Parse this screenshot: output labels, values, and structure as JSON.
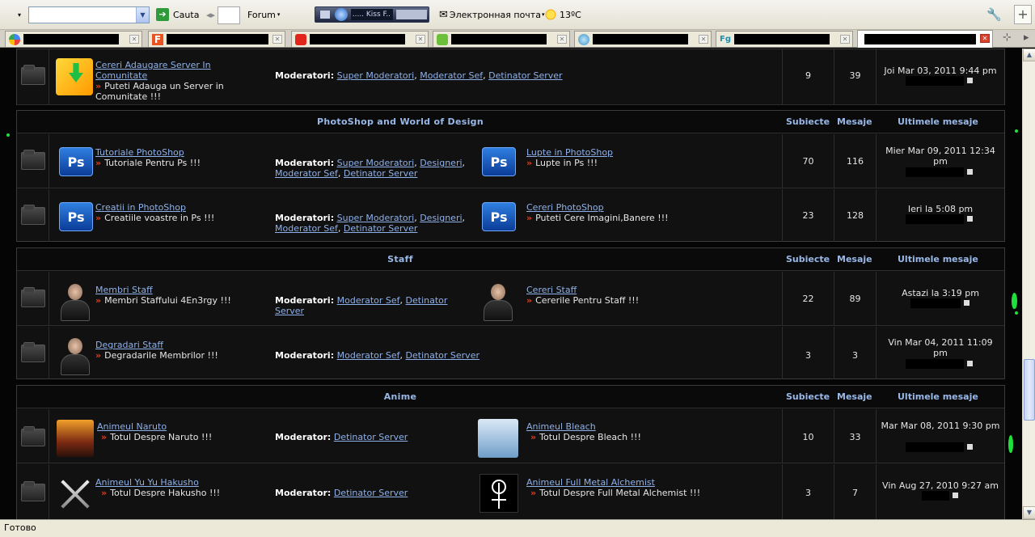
{
  "toolbar": {
    "search_label": "Cauta",
    "forum_label": "Forum",
    "player_title": "..... Kiss F..",
    "email_label": "Электронная почта",
    "weather": "13ºC"
  },
  "tabs": [
    {
      "icon": "google-icon"
    },
    {
      "icon": "f-icon"
    },
    {
      "icon": "youtube-icon"
    },
    {
      "icon": "chat-icon"
    },
    {
      "icon": "globe-icon"
    },
    {
      "icon": "fg-icon"
    },
    {
      "icon": "blank-icon"
    }
  ],
  "header_cols": {
    "topics": "Subiecte",
    "posts": "Mesaje",
    "last": "Ultimele mesaje"
  },
  "mod_label": "Moderatori:",
  "mod_label_single": "Moderator:",
  "top_row": {
    "name": "Cereri Adaugare Server In Comunitate",
    "desc": "Puteti Adauga un Server in Comunitate !!!",
    "mods": [
      "Super Moderatori",
      "Moderator Sef",
      "Detinator Server"
    ],
    "topics": "9",
    "posts": "39",
    "last": "Joi Mar 03, 2011 9:44 pm"
  },
  "categories": [
    {
      "title": "PhotoShop and World of Design",
      "rows": [
        {
          "name": "Tutoriale PhotoShop",
          "desc": "Tutoriale Pentru Ps !!!",
          "mods": [
            "Super Moderatori",
            "Designeri",
            "Moderator Sef",
            "Detinator Server"
          ],
          "sub_name": "Lupte in PhotoShop",
          "sub_desc": "Lupte in Ps !!!",
          "topics": "70",
          "posts": "116",
          "last": "Mier Mar 09, 2011 12:34 pm"
        },
        {
          "name": "Creatii in PhotoShop",
          "desc": "Creatiile voastre in Ps !!!",
          "mods": [
            "Super Moderatori",
            "Designeri",
            "Moderator Sef",
            "Detinator Server"
          ],
          "sub_name": "Cereri PhotoShop",
          "sub_desc": "Puteti Cere Imagini,Banere !!!",
          "topics": "23",
          "posts": "128",
          "last": "Ieri la 5:08 pm"
        }
      ]
    },
    {
      "title": "Staff",
      "rows": [
        {
          "name": "Membri Staff",
          "desc": "Membri Staffului 4En3rgy !!!",
          "mods": [
            "Moderator Sef",
            "Detinator Server"
          ],
          "sub_name": "Cereri Staff",
          "sub_desc": "Cererile Pentru Staff !!!",
          "topics": "22",
          "posts": "89",
          "last": "Astazi la 3:19 pm"
        },
        {
          "name": "Degradari Staff",
          "desc": "Degradarile Membrilor !!!",
          "mods": [
            "Moderator Sef",
            "Detinator Server"
          ],
          "topics": "3",
          "posts": "3",
          "last": "Vin Mar 04, 2011 11:09 pm"
        }
      ]
    },
    {
      "title": "Anime",
      "rows": [
        {
          "name": "Animeul Naruto",
          "desc": "Totul Despre Naruto !!!",
          "mods": [
            "Detinator Server"
          ],
          "sub_name": "Animeul Bleach",
          "sub_desc": "Totul Despre Bleach !!!",
          "topics": "10",
          "posts": "33",
          "last": "Mar Mar 08, 2011 9:30 pm"
        },
        {
          "name": "Animeul Yu Yu Hakusho",
          "desc": "Totul Despre Hakusho !!!",
          "mods": [
            "Detinator Server"
          ],
          "sub_name": "Animeul Full Metal Alchemist",
          "sub_desc": "Totul Despre Full Metal Alchemist !!!",
          "topics": "3",
          "posts": "7",
          "last": "Vin Aug 27, 2010 9:27 am"
        }
      ]
    }
  ],
  "status": "Готово",
  "colors": {
    "link": "#8fb1ea",
    "accent_green": "#1fe03a",
    "bullet": "#e23d1e"
  }
}
